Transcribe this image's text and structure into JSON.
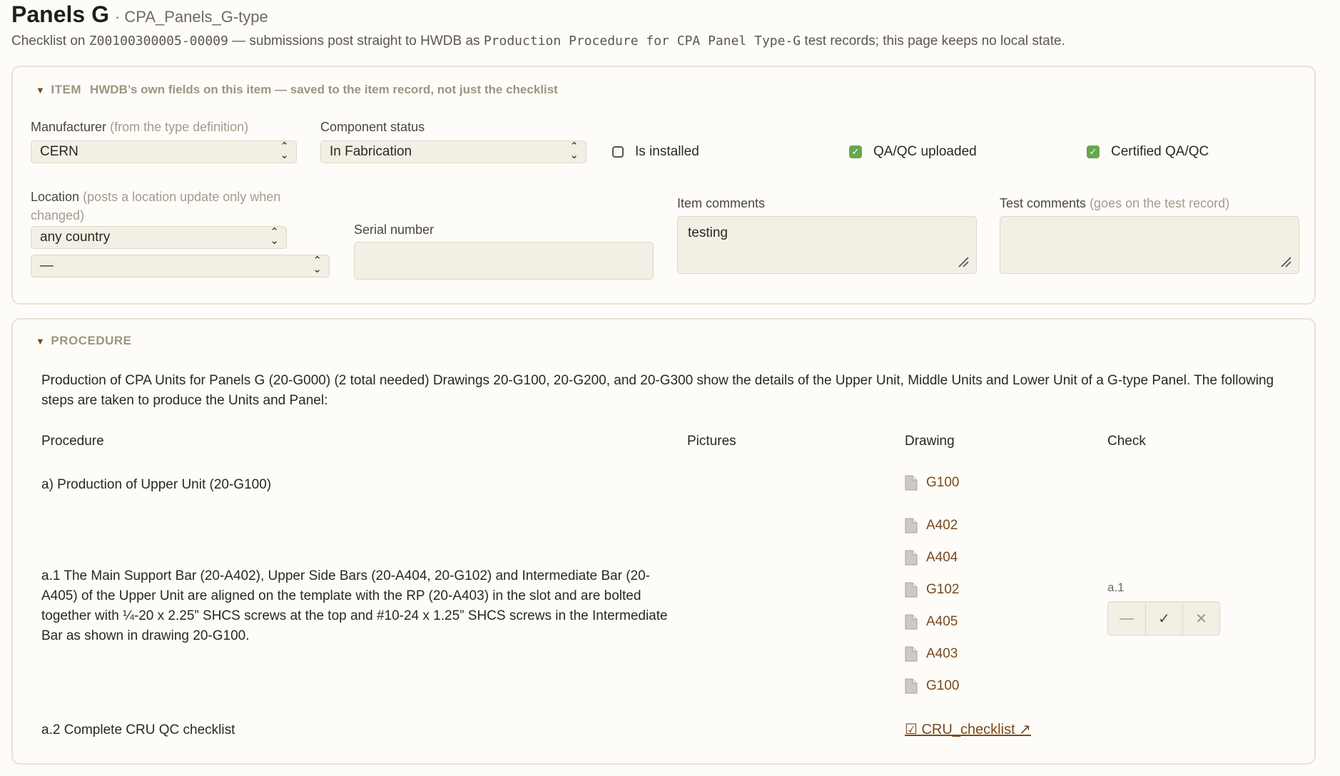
{
  "header": {
    "title": "Panels G",
    "subtitle": "· CPA_Panels_G-type",
    "lede_prefix": "Checklist on ",
    "item_id": "Z00100300005-00009",
    "lede_mid": " — submissions post straight to HWDB as ",
    "procedure_name": "Production Procedure for CPA Panel Type-G",
    "lede_suffix": " test records; this page keeps no local state."
  },
  "item": {
    "section_label": "ITEM",
    "section_note": "HWDB’s own fields on this item — saved to the item record, not just the checklist",
    "manufacturer": {
      "label": "Manufacturer",
      "hint": "(from the type definition)",
      "value": "CERN"
    },
    "component_status": {
      "label": "Component status",
      "value": "In Fabrication"
    },
    "is_installed": {
      "label": "Is installed",
      "checked": false
    },
    "qaqc_uploaded": {
      "label": "QA/QC uploaded",
      "checked": true
    },
    "certified_qaqc": {
      "label": "Certified QA/QC",
      "checked": true
    },
    "location": {
      "label": "Location",
      "hint": "(posts a location update only when",
      "hint2": "changed)",
      "country": "any country",
      "site": "—"
    },
    "serial_number": {
      "label": "Serial number",
      "value": ""
    },
    "item_comments": {
      "label": "Item comments",
      "value": "testing"
    },
    "test_comments": {
      "label": "Test comments",
      "hint": "(goes on the test record)",
      "value": ""
    }
  },
  "procedure": {
    "section_label": "PROCEDURE",
    "intro": "Production of CPA Units for Panels G (20-G000) (2 total needed) Drawings 20-G100, 20-G200, and 20-G300 show the details of the Upper Unit, Middle Units and Lower Unit of a G-type Panel. The following steps are taken to produce the Units and Panel:",
    "columns": [
      "Procedure",
      "Pictures",
      "Drawing",
      "Check"
    ],
    "step_a": {
      "text": "a) Production of Upper Unit (20-G100)",
      "drawing": "G100"
    },
    "step_a1": {
      "text": "a.1 The Main Support Bar (20-A402), Upper Side Bars (20-A404, 20-G102) and Intermediate Bar (20-A405) of the Upper Unit are aligned on the template with the RP (20-A403) in the slot and are bolted together with ¼-20 x 2.25” SHCS screws at the top and #10-24 x 1.25” SHCS screws in the Intermediate Bar as shown in drawing 20-G100.",
      "drawings": [
        "A402",
        "A404",
        "G102",
        "A405",
        "A403",
        "G100"
      ],
      "check_label": "a.1",
      "check_value": "ok",
      "check_symbols": {
        "na": "—",
        "ok": "✓",
        "fail": "✕"
      }
    },
    "step_a2": {
      "text": "a.2 Complete CRU QC checklist",
      "link": "☑ CRU_checklist ↗"
    }
  }
}
